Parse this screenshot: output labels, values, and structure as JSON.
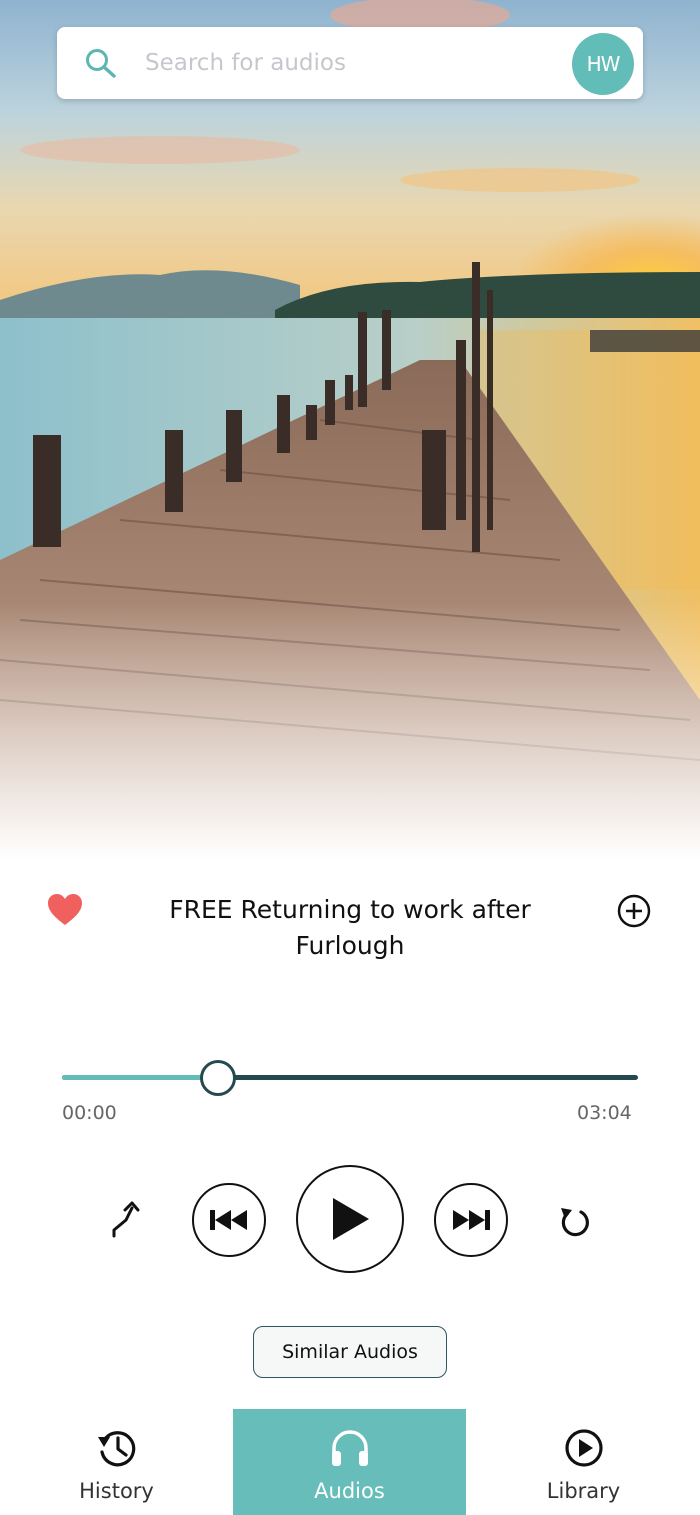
{
  "search": {
    "placeholder": "Search for audios",
    "logo_text": "HW"
  },
  "player": {
    "title": "FREE Returning to work after Furlough",
    "current_time": "00:00",
    "total_time": "03:04",
    "progress": 0.27,
    "favorited": true
  },
  "actions": {
    "similar_label": "Similar Audios"
  },
  "nav": {
    "history_label": "History",
    "audios_label": "Audios",
    "library_label": "Library",
    "active": "audios"
  },
  "colors": {
    "accent": "#62bdb8",
    "heart": "#f0605e",
    "track_dark": "#244a50"
  },
  "icons": {
    "search": "search-icon",
    "heart": "heart-icon",
    "add": "plus-circle-icon",
    "shuffle": "shuffle-icon",
    "previous": "skip-previous-icon",
    "play": "play-icon",
    "next": "skip-next-icon",
    "repeat": "repeat-icon",
    "history": "history-icon",
    "audios": "headphones-icon",
    "library": "play-circle-icon"
  }
}
